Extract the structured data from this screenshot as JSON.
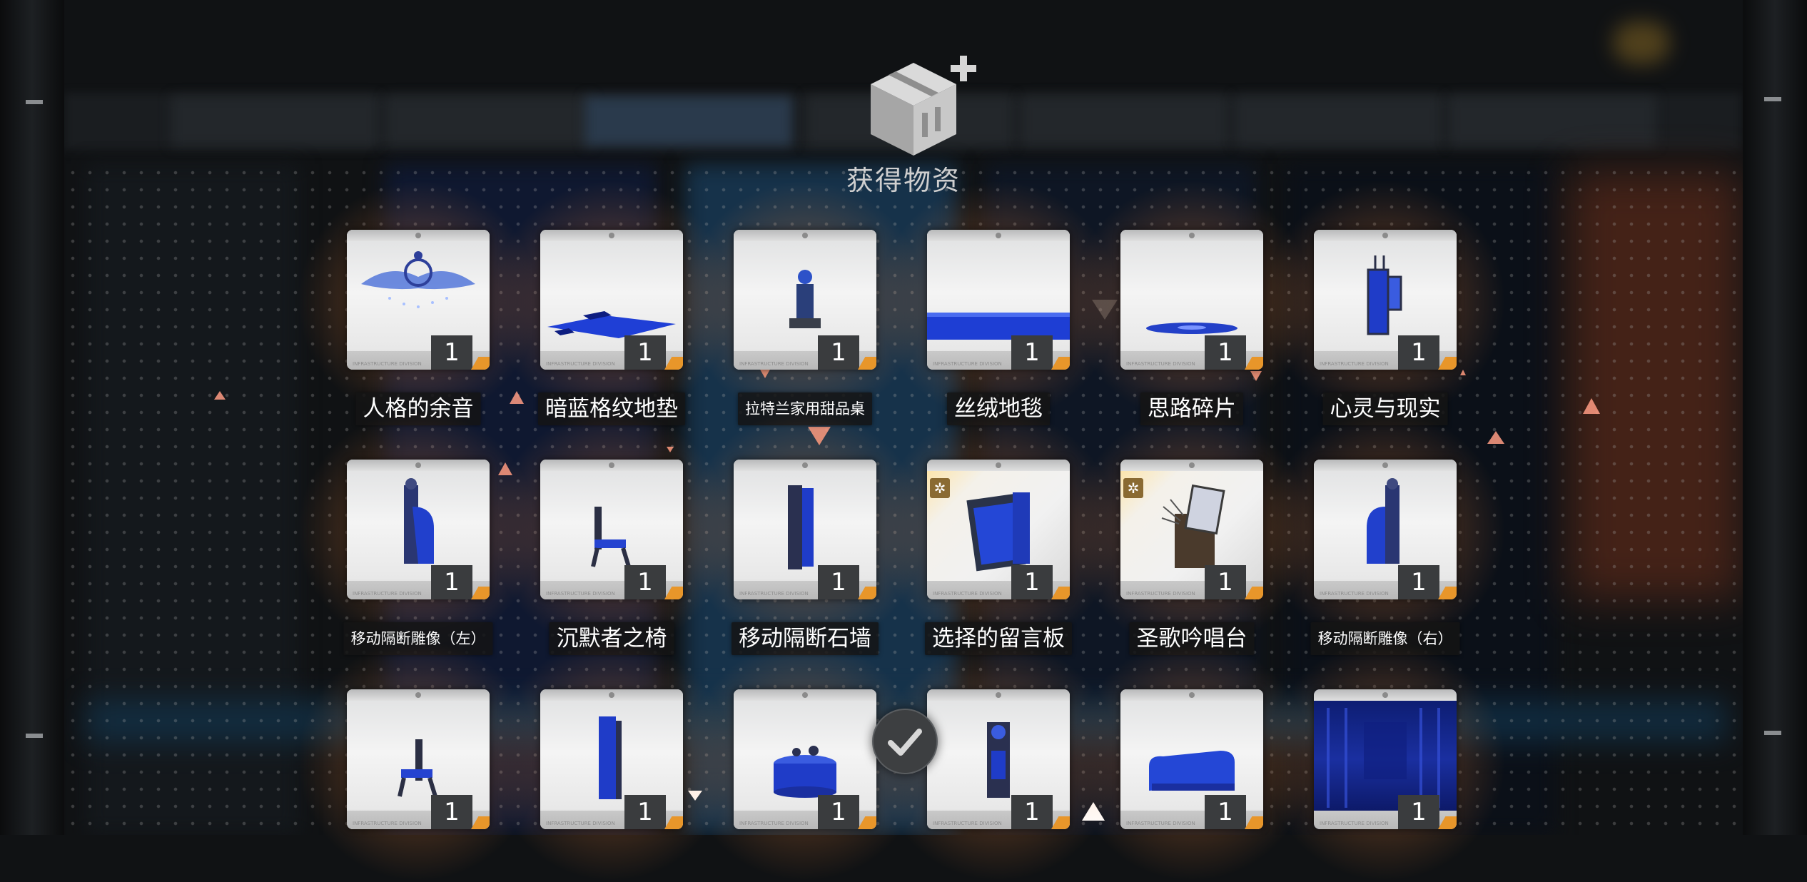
{
  "header": {
    "title": "获得物资",
    "icon": "supply-box-plus-icon"
  },
  "confirm": {
    "icon": "check-icon"
  },
  "card_footer": "INFRASTRUCTURE DIVISION",
  "colors": {
    "accent_orange": "#e8962a",
    "label_bg": "#141414",
    "item_blue": "#1f3fd6"
  },
  "items": [
    {
      "name": "人格的余音",
      "count": "1",
      "icon": "ornament-crest-icon"
    },
    {
      "name": "暗蓝格纹地垫",
      "count": "1",
      "icon": "blue-check-rug-icon"
    },
    {
      "name": "拉特兰家用甜品桌",
      "count": "1",
      "icon": "dessert-table-icon"
    },
    {
      "name": "丝绒地毯",
      "count": "1",
      "icon": "velvet-carpet-icon"
    },
    {
      "name": "思路碎片",
      "count": "1",
      "icon": "thought-shard-icon"
    },
    {
      "name": "心灵与现实",
      "count": "1",
      "icon": "mind-reality-mirror-icon"
    },
    {
      "name": "移动隔断雕像（左）",
      "count": "1",
      "icon": "partition-statue-left-icon"
    },
    {
      "name": "沉默者之椅",
      "count": "1",
      "icon": "silent-chair-icon"
    },
    {
      "name": "移动隔断石墙",
      "count": "1",
      "icon": "partition-stone-wall-icon"
    },
    {
      "name": "选择的留言板",
      "count": "1",
      "icon": "message-board-icon",
      "rare": true
    },
    {
      "name": "圣歌吟唱台",
      "count": "1",
      "icon": "hymn-stand-icon",
      "rare": true
    },
    {
      "name": "移动隔断雕像（右）",
      "count": "1",
      "icon": "partition-statue-right-icon"
    },
    {
      "name": "",
      "count": "1",
      "icon": "chair-icon"
    },
    {
      "name": "",
      "count": "1",
      "icon": "partition-panel-icon"
    },
    {
      "name": "",
      "count": "1",
      "icon": "round-table-icon"
    },
    {
      "name": "",
      "count": "1",
      "icon": "tall-clock-icon"
    },
    {
      "name": "",
      "count": "1",
      "icon": "sofa-icon"
    },
    {
      "name": "",
      "count": "1",
      "icon": "curtain-wall-icon"
    }
  ]
}
